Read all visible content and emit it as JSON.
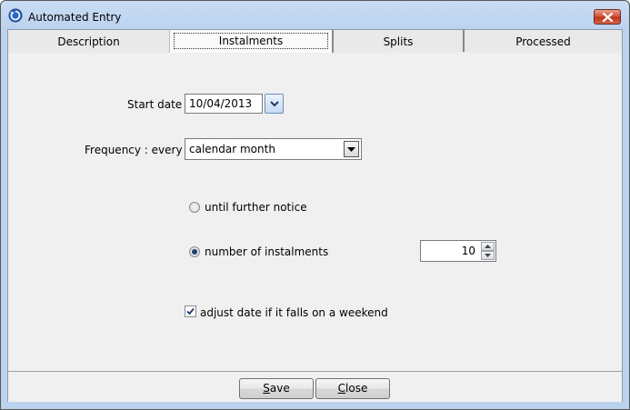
{
  "window": {
    "title": "Automated Entry"
  },
  "tabs": [
    {
      "label": "Description"
    },
    {
      "label": "Instalments"
    },
    {
      "label": "Splits"
    },
    {
      "label": "Processed"
    }
  ],
  "form": {
    "start_date_label": "Start date",
    "start_date_value": "10/04/2013",
    "frequency_label": "Frequency : every",
    "frequency_value": "calendar month",
    "radio_until_label": "until further notice",
    "radio_until_selected": false,
    "radio_number_label": "number of instalments",
    "radio_number_selected": true,
    "instalments_value": "10",
    "weekend_label": "adjust date if it falls on a weekend",
    "weekend_checked": true
  },
  "buttons": {
    "save_mnemonic": "S",
    "save_rest": "ave",
    "close_mnemonic": "C",
    "close_rest": "lose"
  },
  "icons": {
    "app": "refresh-cycle-icon",
    "close": "close-icon",
    "date_dropdown": "chevron-down-icon",
    "frequency_dropdown": "triangle-down-icon",
    "spin_up": "triangle-up-icon",
    "spin_down": "triangle-down-icon",
    "check": "checkmark-icon"
  },
  "colors": {
    "title_bar": "#bcd3ef",
    "close_button": "#c0341c",
    "panel_bg": "#f0f0f0"
  }
}
